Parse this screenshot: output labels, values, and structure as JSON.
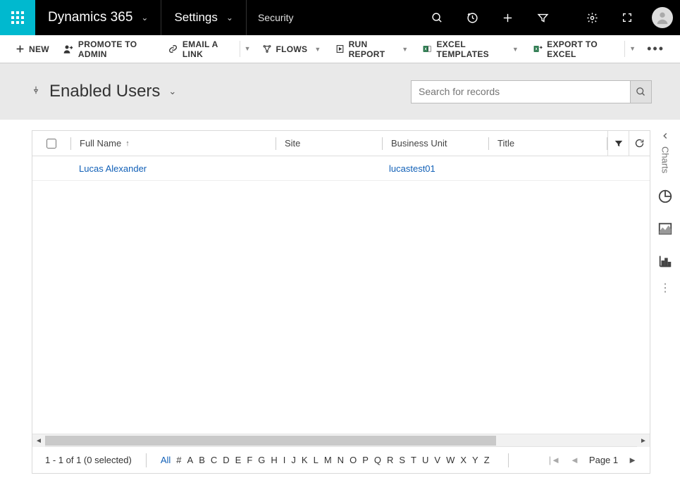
{
  "topbar": {
    "brand": "Dynamics 365",
    "settings": "Settings",
    "area": "Security"
  },
  "commands": {
    "new": "NEW",
    "promote": "PROMOTE TO ADMIN",
    "email": "EMAIL A LINK",
    "flows": "FLOWS",
    "run_report": "RUN REPORT",
    "excel_templates": "EXCEL TEMPLATES",
    "export_excel": "EXPORT TO EXCEL"
  },
  "view": {
    "title": "Enabled Users",
    "search_placeholder": "Search for records"
  },
  "columns": {
    "fullname": "Full Name",
    "site": "Site",
    "bu": "Business Unit",
    "title": "Title"
  },
  "rows": [
    {
      "fullname": "Lucas Alexander",
      "site": "",
      "bu": "lucastest01",
      "title": ""
    }
  ],
  "footer": {
    "count_text": "1 - 1 of 1 (0 selected)",
    "alpha_all": "All",
    "alpha": [
      "#",
      "A",
      "B",
      "C",
      "D",
      "E",
      "F",
      "G",
      "H",
      "I",
      "J",
      "K",
      "L",
      "M",
      "N",
      "O",
      "P",
      "Q",
      "R",
      "S",
      "T",
      "U",
      "V",
      "W",
      "X",
      "Y",
      "Z"
    ],
    "page_label": "Page 1"
  },
  "chartrail": {
    "label": "Charts"
  }
}
